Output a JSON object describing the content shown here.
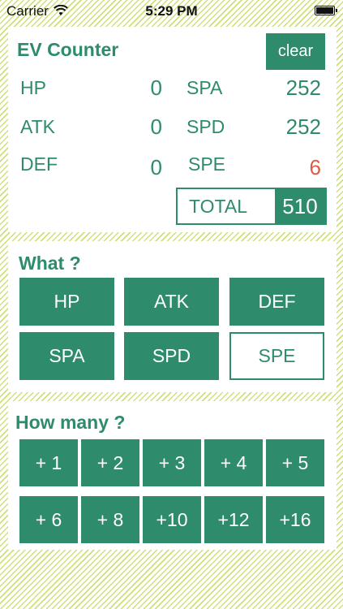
{
  "status_bar": {
    "carrier": "Carrier",
    "time": "5:29 PM"
  },
  "counter": {
    "title": "EV Counter",
    "clear_label": "clear",
    "stats": [
      {
        "label": "HP",
        "value": "0",
        "alert": false
      },
      {
        "label": "ATK",
        "value": "0",
        "alert": false
      },
      {
        "label": "DEF",
        "value": "0",
        "alert": false
      },
      {
        "label": "SPA",
        "value": "252",
        "alert": false
      },
      {
        "label": "SPD",
        "value": "252",
        "alert": false
      },
      {
        "label": "SPE",
        "value": "6",
        "alert": true
      }
    ],
    "total_label": "TOTAL",
    "total_value": "510"
  },
  "what": {
    "title": "What ?",
    "options": [
      "HP",
      "ATK",
      "DEF",
      "SPA",
      "SPD",
      "SPE"
    ],
    "selected": "SPE"
  },
  "how_many": {
    "title": "How many ?",
    "options": [
      "+ 1",
      "+ 2",
      "+ 3",
      "+ 4",
      "+ 5",
      "+ 6",
      "+ 8",
      "+10",
      "+12",
      "+16"
    ]
  },
  "colors": {
    "accent": "#2e8b6b",
    "alert": "#e05a4b",
    "stripe": "#cfe07a"
  }
}
